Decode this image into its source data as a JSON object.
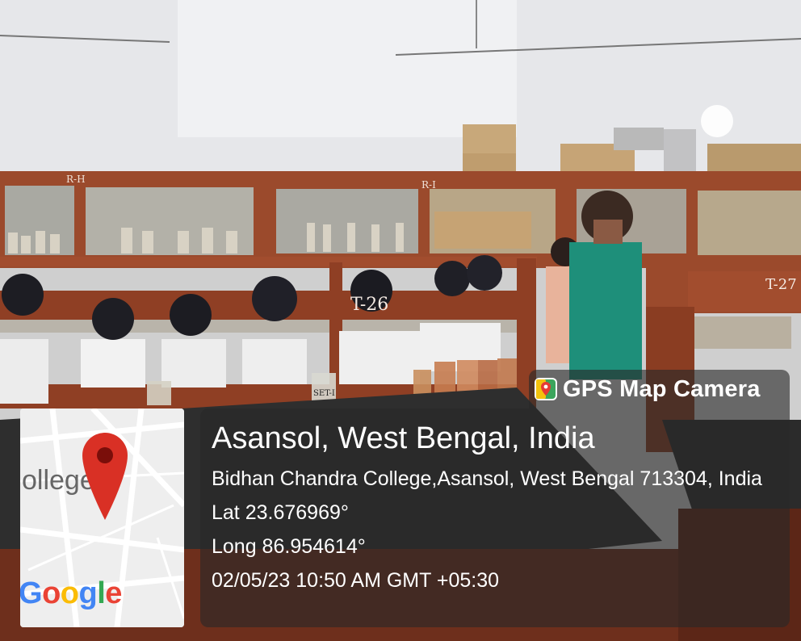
{
  "overlay": {
    "app_name": "GPS Map Camera",
    "city": "Asansol, West Bengal, India",
    "address": "Bidhan Chandra College,Asansol, West Bengal 713304, India",
    "latitude": "Lat 23.676969°",
    "longitude": "Long 86.954614°",
    "datetime": "02/05/23 10:50 AM GMT +05:30"
  },
  "map": {
    "place_label": "ollege",
    "logo_text": "Google",
    "pin_color": "#D93025"
  },
  "scene_labels": {
    "shelf_left": "R-H",
    "shelf_mid": "R-I",
    "table_main": "T-26",
    "table_right": "T-27",
    "bottle_tag": "SET-I"
  },
  "colors": {
    "wood": "#9B4A2C",
    "wall": "#E7E7E9",
    "benchtop": "#2E2E2E",
    "shirt": "#1E8F7A"
  }
}
